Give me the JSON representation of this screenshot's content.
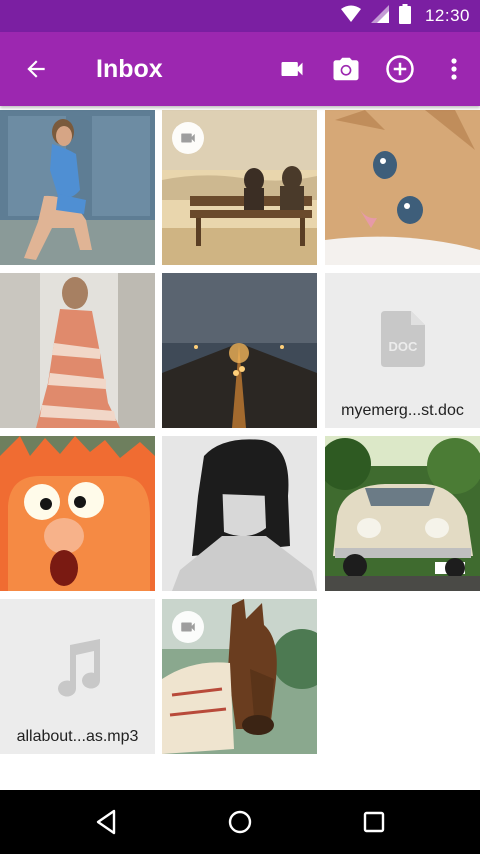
{
  "status_bar": {
    "time": "12:30",
    "icons": [
      "wifi-icon",
      "cellular-signal-icon",
      "battery-icon"
    ]
  },
  "app_bar": {
    "title": "Inbox",
    "color": "#9c27b0",
    "status_color": "#7b1fa2",
    "actions": [
      "back-arrow-icon",
      "videocam-icon",
      "camera-icon",
      "add-circle-icon",
      "more-vertical-icon"
    ]
  },
  "grid": {
    "items": [
      {
        "kind": "photo",
        "subject": "woman in blue top"
      },
      {
        "kind": "video",
        "subject": "couple on bench"
      },
      {
        "kind": "photo",
        "subject": "kitten"
      },
      {
        "kind": "photo",
        "subject": "woman in striped dress"
      },
      {
        "kind": "photo",
        "subject": "foggy road at night"
      },
      {
        "kind": "file",
        "icon": "doc-file-icon",
        "name": "myemerg...st.doc"
      },
      {
        "kind": "photo",
        "subject": "orange muppet"
      },
      {
        "kind": "photo",
        "subject": "woman with bob haircut"
      },
      {
        "kind": "photo",
        "subject": "vintage car"
      },
      {
        "kind": "file",
        "icon": "music-note-icon",
        "name": "allabout...as.mp3"
      },
      {
        "kind": "video",
        "subject": "horse"
      }
    ]
  },
  "nav_bar": {
    "buttons": [
      "back-triangle-icon",
      "home-circle-icon",
      "recents-square-icon"
    ]
  }
}
